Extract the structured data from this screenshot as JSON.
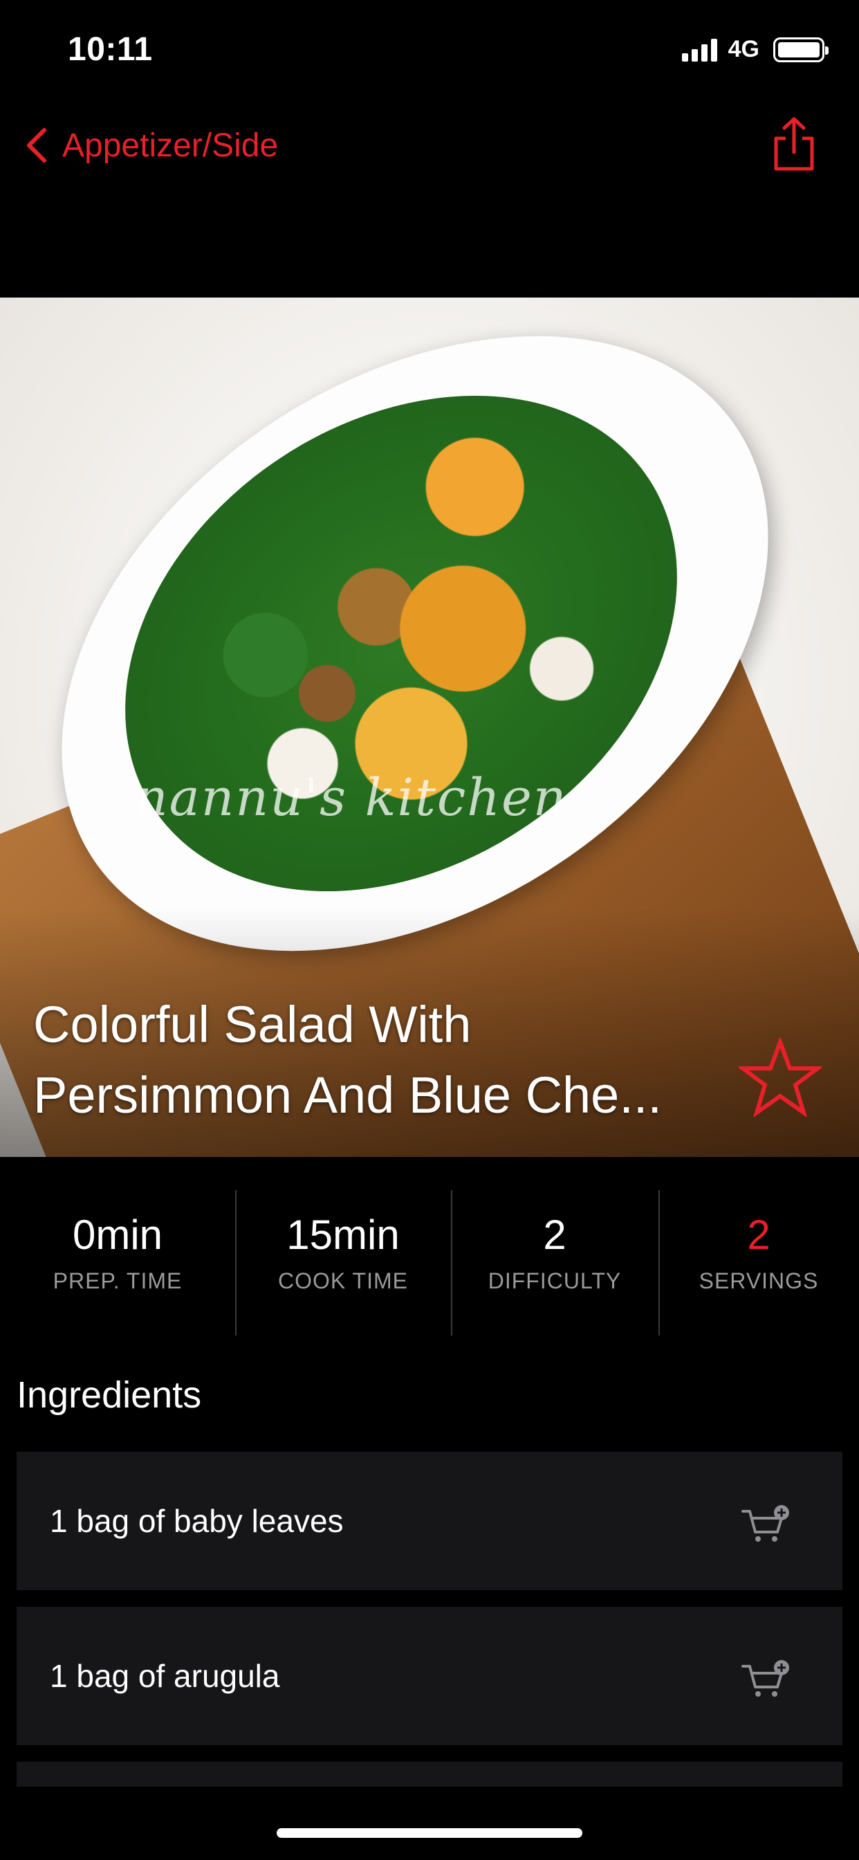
{
  "status_bar": {
    "time": "10:11",
    "network": "4G",
    "signal_bars": 4,
    "battery_icon": "battery-icon"
  },
  "nav": {
    "back_label": "Appetizer/Side",
    "back_icon": "chevron-left-icon",
    "share_icon": "share-icon",
    "accent_color": "#e8202a"
  },
  "hero": {
    "watermark": "nannu's kitchen",
    "title": "Colorful Salad With Persimmon And Blue Che...",
    "favorite_icon": "star-outline-icon"
  },
  "stats": [
    {
      "value": "0min",
      "label": "PREP. TIME",
      "highlight": false
    },
    {
      "value": "15min",
      "label": "COOK TIME",
      "highlight": false
    },
    {
      "value": "2",
      "label": "DIFFICULTY",
      "highlight": false
    },
    {
      "value": "2",
      "label": "SERVINGS",
      "highlight": true
    }
  ],
  "ingredients": {
    "title": "Ingredients",
    "items": [
      {
        "text": "1 bag of baby leaves",
        "icon": "add-to-cart-icon"
      },
      {
        "text": "1 bag of arugula",
        "icon": "add-to-cart-icon"
      }
    ]
  }
}
